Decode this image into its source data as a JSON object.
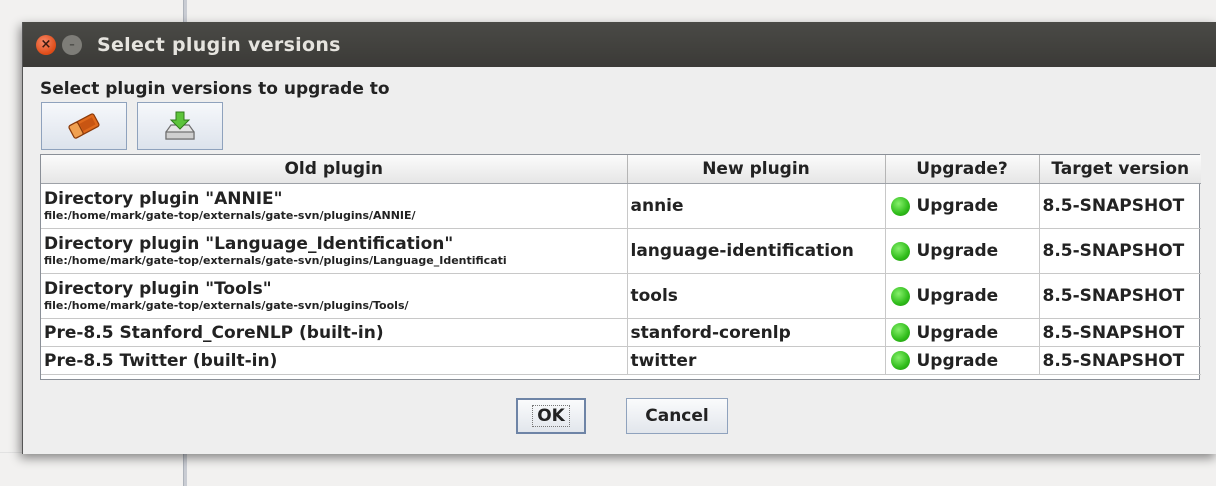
{
  "window": {
    "title": "Select plugin versions"
  },
  "heading": "Select plugin versions to upgrade to",
  "toolbar": [
    {
      "icon": "eraser-icon"
    },
    {
      "icon": "download-icon"
    }
  ],
  "table": {
    "columns": [
      "Old plugin",
      "New plugin",
      "Upgrade?",
      "Target version"
    ],
    "rows": [
      {
        "old": "Directory plugin \"ANNIE\"",
        "path": "file:/home/mark/gate-top/externals/gate-svn/plugins/ANNIE/",
        "new": "annie",
        "upgrade": "Upgrade",
        "target": "8.5-SNAPSHOT"
      },
      {
        "old": "Directory plugin \"Language_Identification\"",
        "path": "file:/home/mark/gate-top/externals/gate-svn/plugins/Language_Identificati",
        "new": "language-identification",
        "upgrade": "Upgrade",
        "target": "8.5-SNAPSHOT"
      },
      {
        "old": "Directory plugin \"Tools\"",
        "path": "file:/home/mark/gate-top/externals/gate-svn/plugins/Tools/",
        "new": "tools",
        "upgrade": "Upgrade",
        "target": "8.5-SNAPSHOT"
      },
      {
        "old": "Pre-8.5 Stanford_CoreNLP (built-in)",
        "new": "stanford-corenlp",
        "upgrade": "Upgrade",
        "target": "8.5-SNAPSHOT"
      },
      {
        "old": "Pre-8.5 Twitter (built-in)",
        "new": "twitter",
        "upgrade": "Upgrade",
        "target": "8.5-SNAPSHOT"
      }
    ]
  },
  "buttons": {
    "ok": "OK",
    "cancel": "Cancel"
  },
  "colors": {
    "status_ok": "#2fbc1a",
    "titlebar": "#3b3a37",
    "close": "#df4b16"
  }
}
